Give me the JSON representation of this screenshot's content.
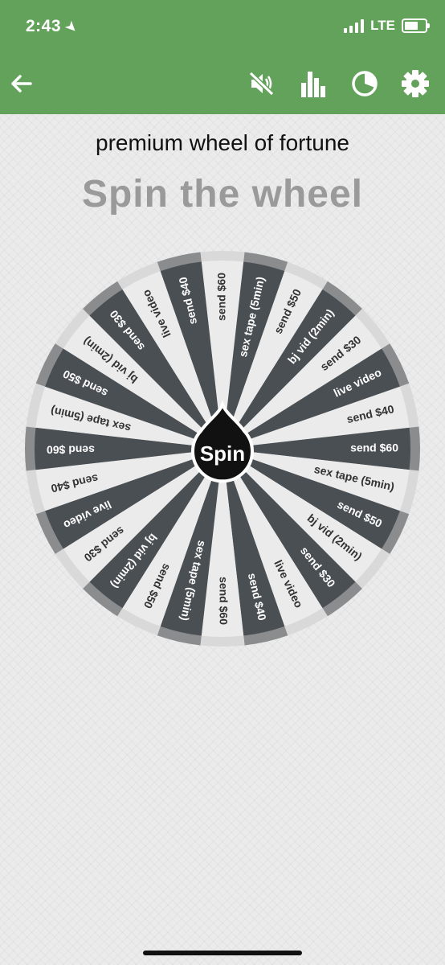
{
  "status_bar": {
    "time": "2:43",
    "network": "LTE"
  },
  "toolbar": {
    "icons": [
      "back-arrow-icon",
      "sound-muted-icon",
      "bar-chart-icon",
      "pie-chart-icon",
      "settings-gear-icon"
    ]
  },
  "subtitle": "premium wheel of fortune",
  "headline": "Spin the wheel",
  "wheel": {
    "spin_label": "Spin",
    "segments": [
      "send $60",
      "sex tape (5min)",
      "send $50",
      "bj vid (2min)",
      "send $30",
      "live video",
      "send $40",
      "send $60",
      "sex tape (5min)",
      "send $50",
      "bj vid (2min)",
      "send $30",
      "live video",
      "send $40",
      "send $60",
      "sex tape (5min)",
      "send $50",
      "bj vid (2min)",
      "send $30",
      "live video",
      "send $40",
      "send $60",
      "sex tape (5min)",
      "send $50",
      "bj vid (2min)",
      "send $30",
      "live video",
      "send $40"
    ]
  },
  "colors": {
    "header": "#62a25a",
    "dark_segment": "#4a4f54",
    "light_segment": "#ebebeb",
    "rim_dark": "#8a8c8e",
    "rim_light": "#d9d9d9"
  }
}
